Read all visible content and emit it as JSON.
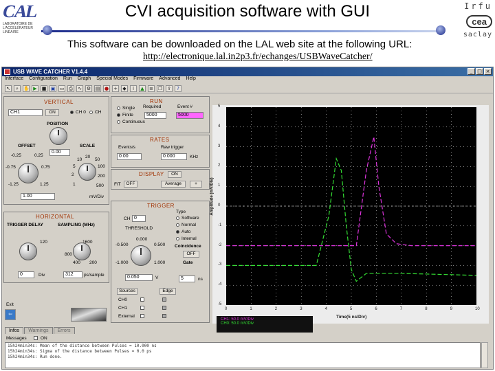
{
  "slide": {
    "title": "CVI acquisition software with GUI",
    "description": "This software can be downloaded on the LAL web site at the following URL:",
    "url": "http://electronique.lal.in2p3.fr/echanges/USBWaveCatcher/",
    "logo_left": "CAL",
    "logo_left_sub": "LABORATOIRE DE L'ACCÉLÉRATEUR LINÉAIRE",
    "logo_right": {
      "top": "Irfu",
      "mid": "cea",
      "bottom": "saclay"
    }
  },
  "app": {
    "title": "USB WAVE CATCHER V1.4.4",
    "menu": [
      "Interface",
      "Configuration",
      "Run",
      "Graph",
      "Special Modes",
      "Firmware",
      "Advanced",
      "Help"
    ],
    "vertical": {
      "title": "VERTICAL",
      "channel": "CH1",
      "on": "ON",
      "ch0_label": "CH 0",
      "ch1_label": "CH",
      "position_label": "POSITION",
      "offset_label": "OFFSET",
      "scale_label": "SCALE",
      "offset_value": "0.00",
      "scale_value": "1.00",
      "scale_unit": "mV/Div",
      "offset_ticks": [
        "-0.25",
        "0.25",
        "-0.75",
        "0.75",
        "-1.25",
        "1.25"
      ],
      "scale_ticks": [
        "10",
        "20",
        "50",
        "5",
        "100",
        "2",
        "200",
        "1",
        "500"
      ]
    },
    "run": {
      "title": "RUN",
      "modes": [
        "Single",
        "Finite",
        "Continuous"
      ],
      "required_label": "Required",
      "required_value": "5000",
      "event_label": "Event #",
      "event_value": "5000"
    },
    "rates": {
      "title": "RATES",
      "events_label": "Events/s",
      "events_value": "0.00",
      "trigger_label": "Raw trigger",
      "trigger_value": "0.000",
      "trigger_unit": "KHz"
    },
    "display": {
      "title": "DISPLAY",
      "state": "ON",
      "fit_label": "FIT",
      "fit_value": "OFF",
      "average_label": "Average"
    },
    "horizontal": {
      "title": "HORIZONTAL",
      "delay_label": "TRIGGER DELAY",
      "sampling_label": "SAMPLING (MHz)",
      "delay_value": "0",
      "delay_unit": "Div",
      "sampling_value": "312",
      "sampling_unit": "ps/sample",
      "delay_ticks": [
        "120"
      ],
      "sampling_ticks": [
        "1600",
        "800",
        "400",
        "200"
      ]
    },
    "trigger": {
      "title": "TRIGGER",
      "ch_label": "CH",
      "ch_value": "0",
      "threshold_label": "THRESHOLD",
      "threshold_value": "0.050",
      "threshold_unit": "V",
      "type_label": "Type",
      "types": [
        "Software",
        "Normal",
        "Auto",
        "Internal"
      ],
      "coincidence_label": "Coincidence",
      "coincidence_value": "OFF",
      "gate_label": "Gate",
      "gate_value": "5",
      "gate_unit": "ns",
      "source_label": "Sources",
      "edge_label": "Edge",
      "sources": [
        "CH0",
        "CH1",
        "External"
      ],
      "threshold_ticks": [
        "0.000",
        "-0.500",
        "0.500",
        "-1.000",
        "1.000"
      ]
    },
    "exit_label": "Exit",
    "graph": {
      "ylabel": "Amplitude (mV/Div)",
      "xlabel": "Time(5 ns/Div)",
      "yticks": [
        "5",
        "4",
        "3",
        "2",
        "1",
        "0",
        "-1",
        "-2",
        "-3",
        "-4",
        "-5"
      ],
      "xticks": [
        "0",
        "1",
        "2",
        "3",
        "4",
        "5",
        "6",
        "7",
        "8",
        "9",
        "10"
      ],
      "cursor_ch0": "CH0: 50.0 mV/Div",
      "cursor_ch1": "CH1: 50.0 mV/Div"
    },
    "tabs": [
      "Infos",
      "Warnings",
      "Errors"
    ],
    "messages_label": "Messages",
    "messages_toggle": "ON",
    "messages": [
      "15h24min34s: Mean of the distance between Pulses = 10.000 ns",
      "15h24min34s: Sigma of the distance between Pulses = 0.0 ps",
      "15h24min34s: Run done."
    ]
  },
  "colors": {
    "ch0": "#33dd33",
    "ch1": "#dd33dd",
    "accent": "#1b2a8a"
  }
}
